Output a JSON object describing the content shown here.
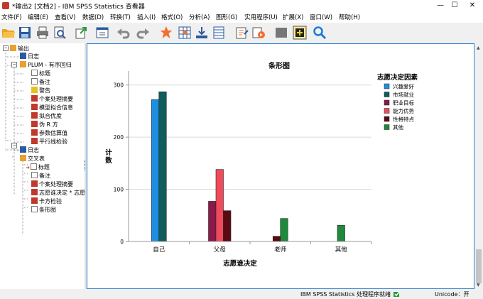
{
  "window": {
    "title": "*输出2 [文档2] - IBM SPSS Statistics 查看器",
    "minimize": "—",
    "maximize": "☐",
    "close": "✕"
  },
  "menu": [
    "文件(F)",
    "编辑(E)",
    "查看(V)",
    "数据(D)",
    "转换(T)",
    "插入(I)",
    "格式(O)",
    "分析(A)",
    "图形(G)",
    "实用程序(U)",
    "扩展(X)",
    "窗口(W)",
    "帮助(H)"
  ],
  "toolbar_icons": [
    "open-icon",
    "save-icon",
    "print-icon",
    "print-preview-icon",
    "export-icon",
    "recall-dialog-icon",
    "undo-icon",
    "redo-icon",
    "goto-data-icon",
    "goto-case-icon",
    "goto-variable-icon",
    "variables-icon",
    "designate-window-icon",
    "run-script-icon",
    "hide-icon",
    "insert-output-icon",
    "find-icon"
  ],
  "tree": [
    {
      "label": "输出",
      "icon": "output-book-icon",
      "toggle": "−"
    },
    {
      "label": "日志",
      "icon": "log-icon"
    },
    {
      "label": "PLUM - 有序回归",
      "icon": "output-book-icon",
      "toggle": "−"
    },
    {
      "label": "标题",
      "icon": "title-icon"
    },
    {
      "label": "备注",
      "icon": "notes-icon"
    },
    {
      "label": "警告",
      "icon": "warning-icon"
    },
    {
      "label": "个案处理摘要",
      "icon": "table-icon"
    },
    {
      "label": "模型拟合信息",
      "icon": "table-icon"
    },
    {
      "label": "拟合优度",
      "icon": "table-icon"
    },
    {
      "label": "伪 R 方",
      "icon": "table-icon"
    },
    {
      "label": "参数估算值",
      "icon": "table-icon"
    },
    {
      "label": "平行线检验",
      "icon": "table-icon"
    },
    {
      "label": "日志",
      "icon": "log-icon"
    },
    {
      "label": "交叉表",
      "icon": "output-book-icon",
      "toggle": "−"
    },
    {
      "label": "标题",
      "icon": "title-icon"
    },
    {
      "label": "备注",
      "icon": "notes-icon"
    },
    {
      "label": "个案处理摘要",
      "icon": "table-icon"
    },
    {
      "label": "志愿谁决定 * 志愿",
      "icon": "table-icon"
    },
    {
      "label": "卡方检验",
      "icon": "table-icon"
    },
    {
      "label": "条形图",
      "icon": "chart-icon"
    }
  ],
  "status": {
    "processor": "IBM SPSS Statistics 处理程序就绪",
    "unicode": "Unicode：开"
  },
  "colors": {
    "accent": "#2a7fd4",
    "series": [
      "#1e8fe0",
      "#0f5d5d",
      "#8b1a4a",
      "#f04b5c",
      "#5a0a12",
      "#1f8a3c"
    ]
  },
  "chart_data": {
    "type": "bar",
    "title": "条形图",
    "xlabel": "志愿谁决定",
    "ylabel": "计数",
    "legend_title": "志愿决定因素",
    "legend_position": "right",
    "categories": [
      "自己",
      "父母",
      "老师",
      "其他"
    ],
    "series": [
      {
        "name": "兴趣爱好",
        "values": [
          272,
          0,
          0,
          0
        ]
      },
      {
        "name": "市场就业",
        "values": [
          287,
          0,
          0,
          0
        ]
      },
      {
        "name": "职业目标",
        "values": [
          0,
          77,
          0,
          0
        ]
      },
      {
        "name": "能力优势",
        "values": [
          0,
          138,
          0,
          0
        ]
      },
      {
        "name": "性格特点",
        "values": [
          0,
          59,
          10,
          0
        ]
      },
      {
        "name": "其他",
        "values": [
          0,
          0,
          44,
          31
        ]
      }
    ],
    "yticks": [
      0,
      100,
      200,
      300
    ],
    "ylim": [
      0,
      320
    ],
    "grid": true
  }
}
